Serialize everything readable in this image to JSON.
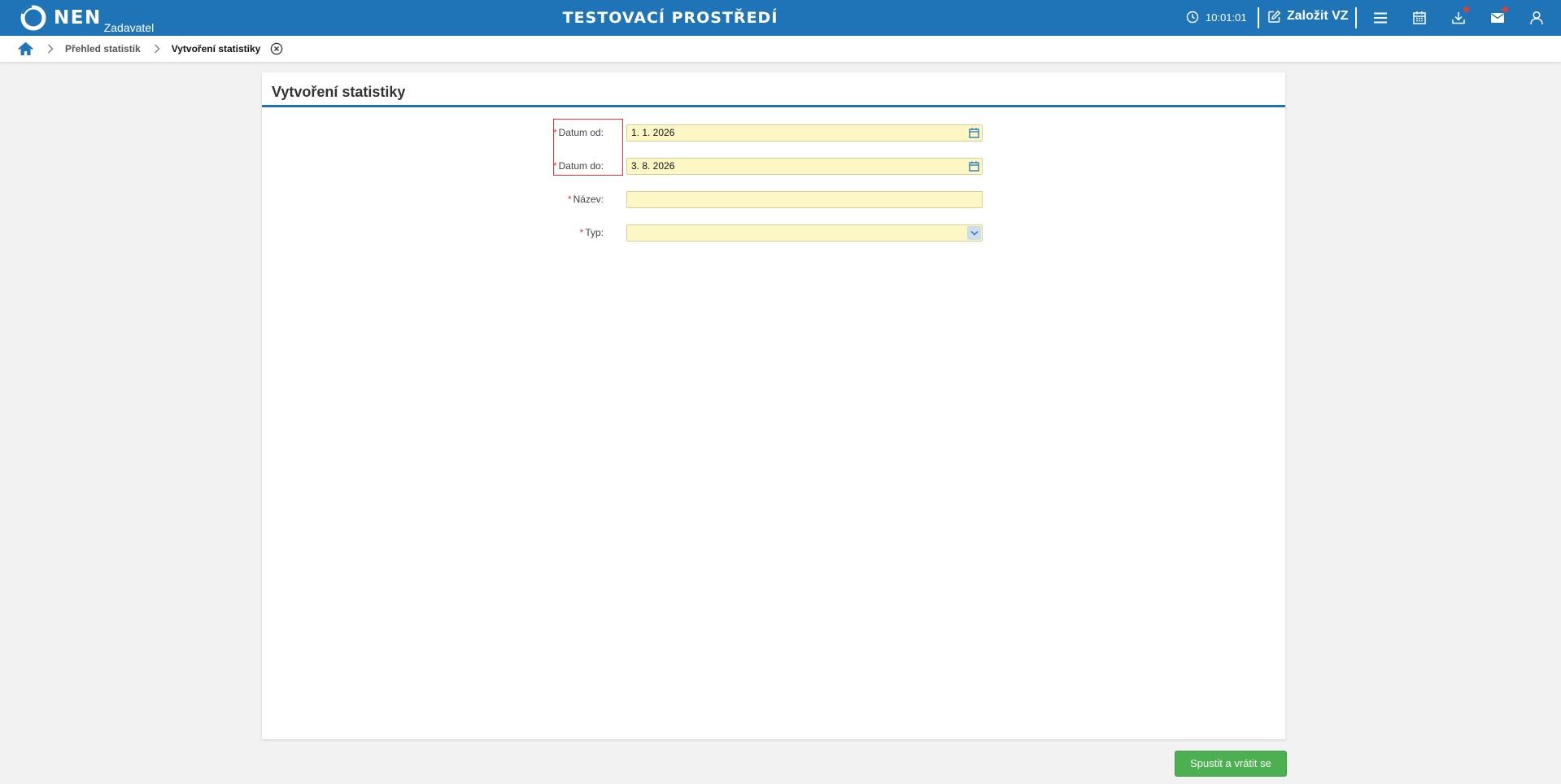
{
  "header": {
    "logo_text": "NEN",
    "logo_subtitle": "Zadavatel",
    "environment": "TESTOVACÍ PROSTŘEDÍ",
    "clock": "10:01:01",
    "create_label": "Založit VZ",
    "icons": [
      "clock-icon",
      "edit-icon",
      "menu-icon",
      "calendar-icon",
      "download-icon",
      "mail-icon",
      "user-icon"
    ],
    "brand_color": "#1f74b8",
    "notification_color": "#e53935"
  },
  "breadcrumb": {
    "items": [
      "Přehled statistik",
      "Vytvoření statistiky"
    ]
  },
  "form": {
    "title": "Vytvoření statistiky",
    "fields": [
      {
        "label": "Datum od:",
        "value": "1. 1. 2026",
        "required": true
      },
      {
        "label": "Datum do:",
        "value": "3. 8. 2026",
        "required": true
      },
      {
        "label": "Název:",
        "value": "",
        "required": true
      },
      {
        "label": "Typ:",
        "value": "",
        "required": true
      }
    ],
    "required_mark": "*",
    "input_bg": "#fdf7c6"
  },
  "actions": {
    "run_label": "Spustit a vrátit se",
    "run_color": "#4caf50"
  }
}
